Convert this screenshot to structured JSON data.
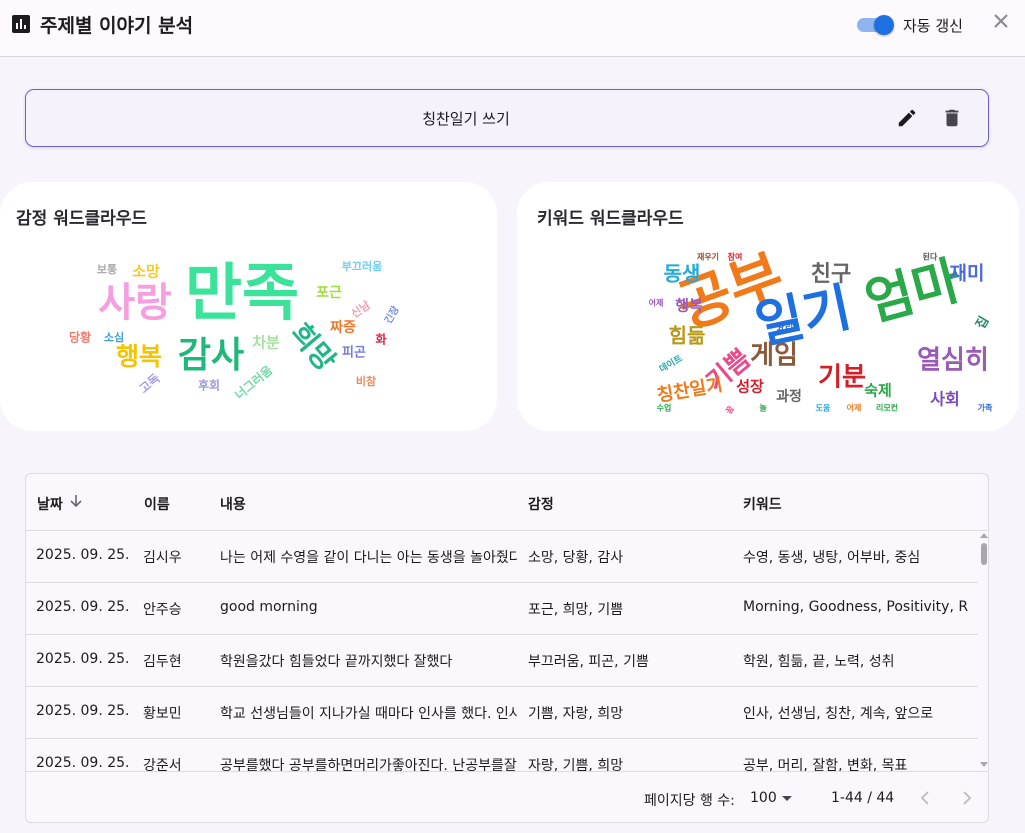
{
  "header": {
    "title": "주제별 이야기 분석",
    "toggle_label": "자동 갱신",
    "toggle_on": true
  },
  "topic": {
    "text": "칭찬일기 쓰기"
  },
  "emotion_cloud": {
    "title": "감정 워드클라우드",
    "words": [
      {
        "text": "만족",
        "color": "#3be39a"
      },
      {
        "text": "사랑",
        "color": "#f59ee0"
      },
      {
        "text": "감사",
        "color": "#1fb87a"
      },
      {
        "text": "행복",
        "color": "#f5c400"
      },
      {
        "text": "희망",
        "color": "#22b58a"
      },
      {
        "text": "보통",
        "color": "#aaaaaa"
      },
      {
        "text": "소망",
        "color": "#f6ca2a"
      },
      {
        "text": "부끄러움",
        "color": "#6ecff0"
      },
      {
        "text": "포근",
        "color": "#9adf3a"
      },
      {
        "text": "신남",
        "color": "#f0a0b0"
      },
      {
        "text": "긴장",
        "color": "#7a8fe6"
      },
      {
        "text": "짜증",
        "color": "#f07a2a"
      },
      {
        "text": "화",
        "color": "#e0204a"
      },
      {
        "text": "당황",
        "color": "#f27a6a"
      },
      {
        "text": "소심",
        "color": "#3fa0d8"
      },
      {
        "text": "차분",
        "color": "#a8e0a0"
      },
      {
        "text": "피곤",
        "color": "#7a7ad8"
      },
      {
        "text": "고독",
        "color": "#a89af0"
      },
      {
        "text": "후회",
        "color": "#9a9ae0"
      },
      {
        "text": "너그러움",
        "color": "#70d8a8"
      },
      {
        "text": "비참",
        "color": "#f08a5a"
      }
    ]
  },
  "keyword_cloud": {
    "title": "키워드 워드클라우드",
    "words": [
      {
        "text": "공부",
        "color": "#f07a1a"
      },
      {
        "text": "일기",
        "color": "#1e6fe0"
      },
      {
        "text": "엄마",
        "color": "#2aa84a"
      },
      {
        "text": "동생",
        "color": "#22aad8"
      },
      {
        "text": "친구",
        "color": "#666666"
      },
      {
        "text": "재미",
        "color": "#4a6ad8"
      },
      {
        "text": "게임",
        "color": "#8a5a3a"
      },
      {
        "text": "기분",
        "color": "#d0202a"
      },
      {
        "text": "열심히",
        "color": "#9a5ab8"
      },
      {
        "text": "힘듦",
        "color": "#b89a1a"
      },
      {
        "text": "기쁨",
        "color": "#e84a8a"
      },
      {
        "text": "행복",
        "color": "#9a5ab8"
      },
      {
        "text": "칭찬일기",
        "color": "#f07a1a"
      },
      {
        "text": "성장",
        "color": "#d0202a"
      },
      {
        "text": "숙제",
        "color": "#2aa84a"
      },
      {
        "text": "사회",
        "color": "#7a4ab8"
      },
      {
        "text": "과정",
        "color": "#666666"
      },
      {
        "text": "집",
        "color": "#2a8a6a"
      },
      {
        "text": "재우기",
        "color": "#9a4a2a"
      },
      {
        "text": "참여",
        "color": "#d0202a"
      },
      {
        "text": "된다",
        "color": "#555555"
      },
      {
        "text": "어제",
        "color": "#9a4ab8"
      },
      {
        "text": "요리",
        "color": "#2a6ad8"
      },
      {
        "text": "데이트",
        "color": "#2aa8a8"
      },
      {
        "text": "수업",
        "color": "#2aa84a"
      },
      {
        "text": "꿈",
        "color": "#e84a8a"
      },
      {
        "text": "놀",
        "color": "#2aa84a"
      },
      {
        "text": "도움",
        "color": "#22aad8"
      },
      {
        "text": "어제",
        "color": "#f07a1a"
      },
      {
        "text": "리모컨",
        "color": "#2aa84a"
      },
      {
        "text": "가족",
        "color": "#2a6ad8"
      }
    ]
  },
  "table": {
    "headers": {
      "date": "날짜",
      "name": "이름",
      "content": "내용",
      "emotion": "감정",
      "keyword": "키워드"
    },
    "rows": [
      {
        "date": "2025. 09. 25.",
        "name": "김시우",
        "content": "나는 어제 수영을 같이 다니는 아는 동생을 놀아줬다",
        "emotion": "소망, 당황, 감사",
        "keyword": "수영, 동생, 냉탕, 어부바, 중심"
      },
      {
        "date": "2025. 09. 25.",
        "name": "안주승",
        "content": "good morning",
        "emotion": "포근, 희망, 기쁨",
        "keyword": "Morning, Goodness, Positivity, R…"
      },
      {
        "date": "2025. 09. 25.",
        "name": "김두현",
        "content": "학원을갔다 힘들었다 끝까지했다 잘했다",
        "emotion": "부끄러움, 피곤, 기쁨",
        "keyword": "학원, 힘듦, 끝, 노력, 성취"
      },
      {
        "date": "2025. 09. 25.",
        "name": "황보민",
        "content": "학교 선생님들이 지나가실 때마다 인사를 했다. 인사",
        "emotion": "기쁨, 자랑, 희망",
        "keyword": "인사, 선생님, 칭찬, 계속, 앞으로"
      },
      {
        "date": "2025. 09. 25.",
        "name": "강준서",
        "content": "공부를했다 공부를하면머리가좋아진다. 난공부를잘",
        "emotion": "자랑, 기쁨, 희망",
        "keyword": "공부, 머리, 잘함, 변화, 목표"
      }
    ],
    "footer": {
      "rows_per_page_label": "페이지당 행 수:",
      "rows_per_page": "100",
      "range": "1-44 / 44"
    }
  }
}
